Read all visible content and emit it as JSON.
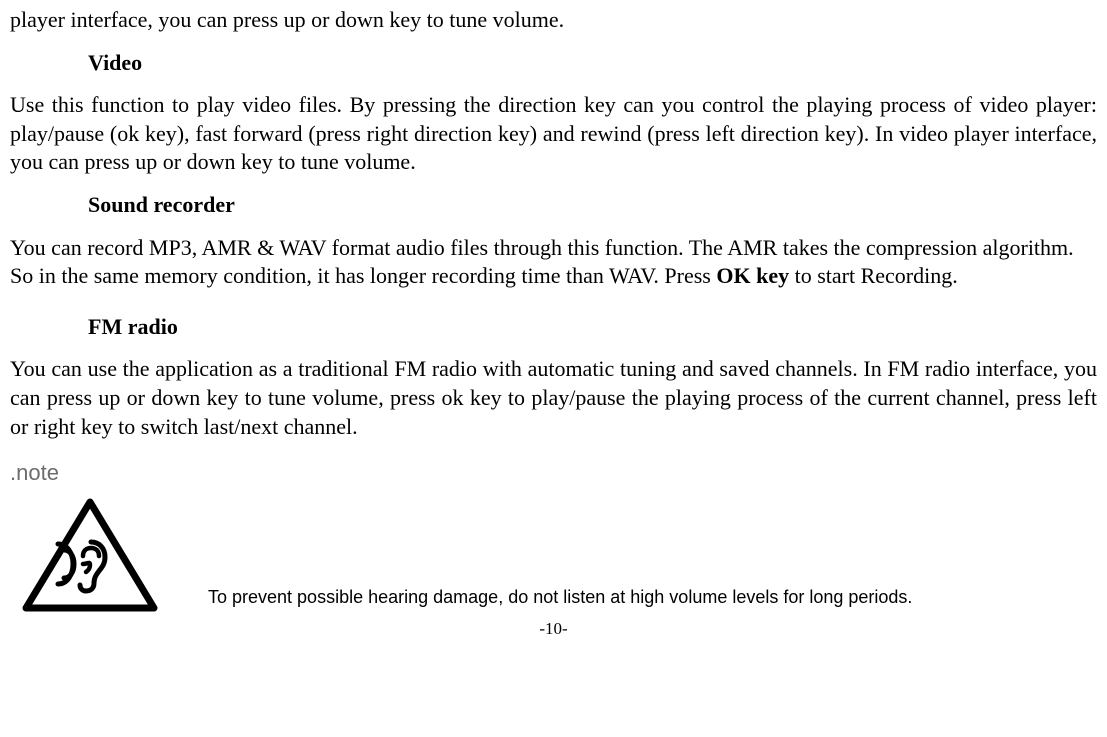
{
  "intro_tail": "player interface, you can press up or down key to tune volume.",
  "sections": {
    "video": {
      "title": "Video",
      "body": "Use this function to play video files. By pressing the direction key can you control the playing process of video player: play/pause (ok key), fast forward (press right direction key) and rewind (press left direction key). In video player interface, you can press up or down key to tune volume."
    },
    "sound_recorder": {
      "title": "Sound recorder",
      "body_prefix": "You can record MP3, AMR & WAV format audio files through this function. The AMR takes the compression algorithm. So in the same memory condition, it has longer recording time than WAV. Press ",
      "body_bold": "OK key",
      "body_suffix": " to start Recording."
    },
    "fm_radio": {
      "title": "FM radio",
      "body": "You can use the application as a traditional FM radio with automatic tuning and saved channels. In FM radio interface, you can press up or down key to tune volume, press ok key to play/pause the playing process of the current channel, press left or right key to switch last/next channel."
    }
  },
  "note": {
    "label": ".note",
    "warning_text": "To prevent possible hearing damage, do not listen at high volume levels for long periods."
  },
  "page_number": "-10-"
}
